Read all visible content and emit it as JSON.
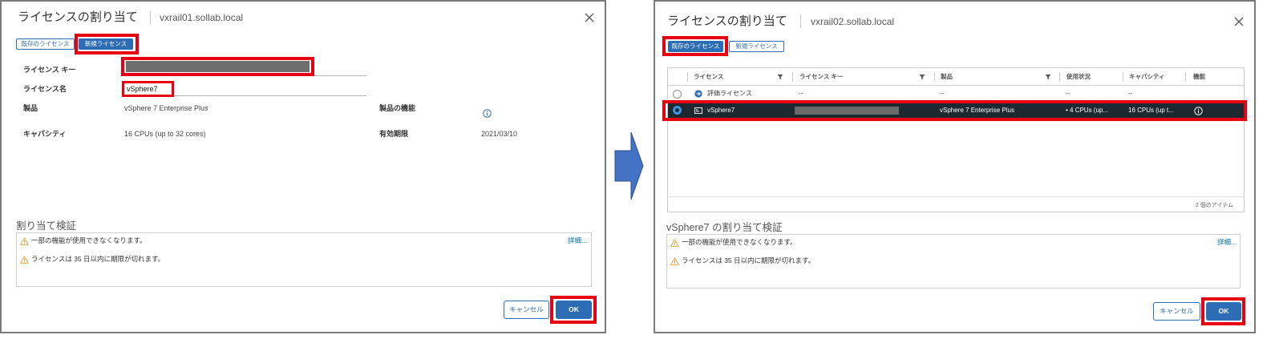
{
  "colors": {
    "primary": "#2d6db5",
    "link": "#0072a3",
    "annotation": "#e60012",
    "warning": "#e49b2c",
    "selected_row": "#1d2830",
    "arrow": "#4472c4"
  },
  "left": {
    "title": "ライセンスの割り当て",
    "host": "vxrail01.sollab.local",
    "close_icon": "close-icon",
    "tabs": [
      {
        "label": "既存のライセンス",
        "selected": false
      },
      {
        "label": "新規ライセンス",
        "selected": true
      }
    ],
    "form": {
      "license_key": {
        "label": "ライセンス キー"
      },
      "license_name": {
        "label": "ライセンス名",
        "value": "vSphere7"
      },
      "product": {
        "label": "製品",
        "value": "vSphere 7 Enterprise Plus"
      },
      "features": {
        "label": "製品の機能",
        "icon": "info-icon"
      },
      "capacity": {
        "label": "キャパシティ",
        "value": "16 CPUs (up to 32 cores)"
      },
      "expiration": {
        "label": "有効期限",
        "value": "2021/03/10"
      }
    },
    "validation": {
      "title": "割り当て検証",
      "warnings": [
        "一部の機能が使用できなくなります。",
        "ライセンスは 35 日以内に期限が切れます。"
      ],
      "details_link": "詳細..."
    },
    "buttons": {
      "cancel": "キャンセル",
      "ok": "OK"
    }
  },
  "right": {
    "title": "ライセンスの割り当て",
    "host": "vxrail02.sollab.local",
    "close_icon": "close-icon",
    "tabs": [
      {
        "label": "既存のライセンス",
        "selected": true
      },
      {
        "label": "新規ライセンス",
        "selected": false
      }
    ],
    "table": {
      "columns": [
        "ライセンス",
        "ライセンス キー",
        "製品",
        "使用状況",
        "キャパシティ",
        "機能"
      ],
      "rows": [
        {
          "icon": "evaluation-license-icon",
          "license": "評価ライセンス",
          "key": "--",
          "product": "--",
          "usage": "--",
          "capacity": "--",
          "selected": false
        },
        {
          "icon": "license-icon",
          "license": "vSphere7",
          "product": "vSphere 7 Enterprise Plus",
          "usage": "• 4 CPUs (up...",
          "capacity": "16 CPUs (up t...",
          "features_icon": "info-icon",
          "selected": true
        }
      ],
      "footer": "2 個のアイテム"
    },
    "validation": {
      "title": "vSphere7 の割り当て検証",
      "warnings": [
        "一部の機能が使用できなくなります。",
        "ライセンスは 35 日以内に期限が切れます。"
      ],
      "details_link": "詳細..."
    },
    "buttons": {
      "cancel": "キャンセル",
      "ok": "OK"
    }
  }
}
